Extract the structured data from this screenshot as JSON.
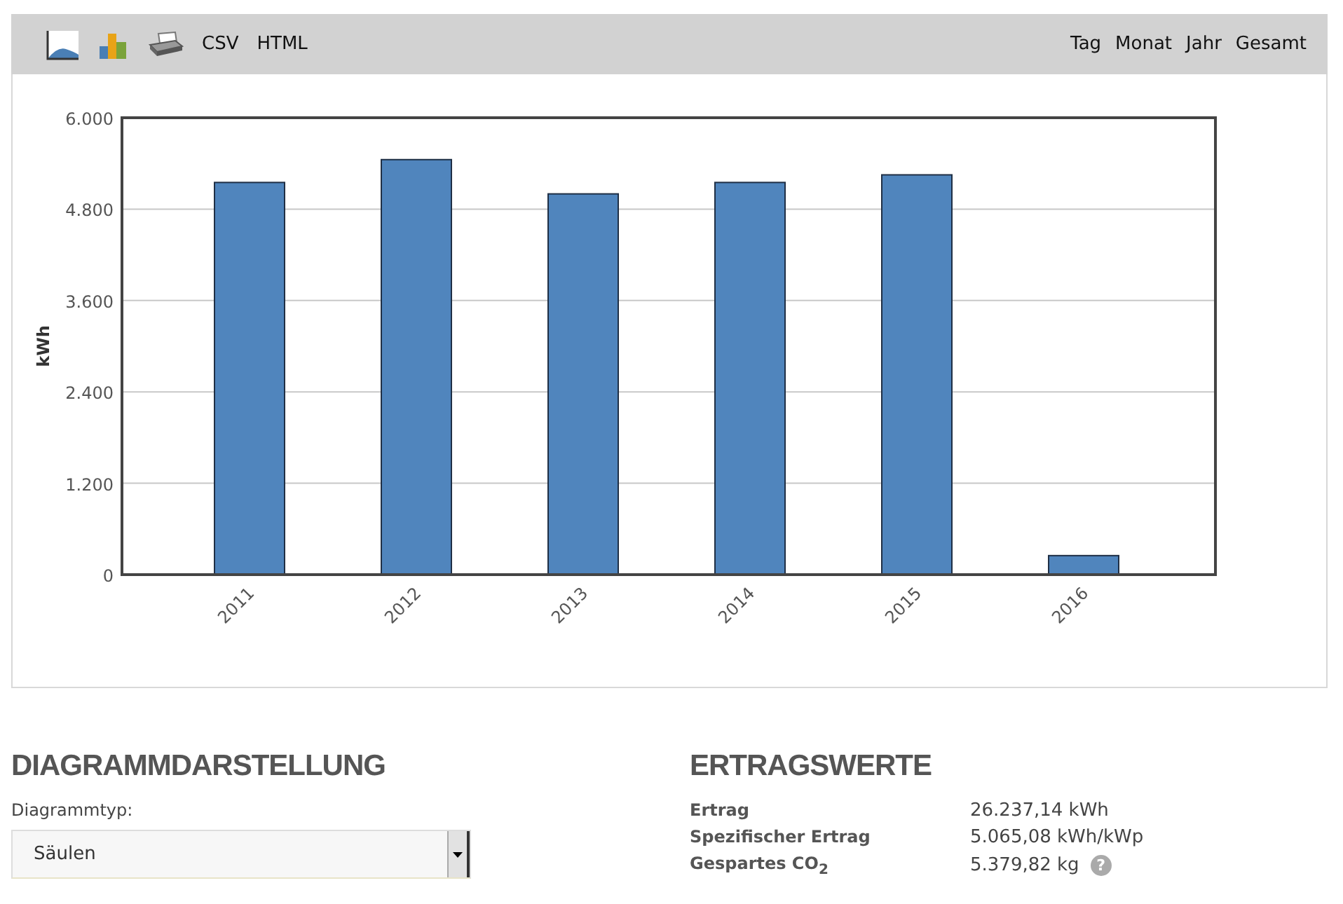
{
  "toolbar": {
    "exports": [
      "CSV",
      "HTML"
    ],
    "periods": [
      "Tag",
      "Monat",
      "Jahr",
      "Gesamt"
    ]
  },
  "chart": {
    "chart_data": {
      "type": "bar",
      "ylabel": "kWh",
      "categories": [
        "2011",
        "2012",
        "2013",
        "2014",
        "2015",
        "2016"
      ],
      "values": [
        5150,
        5450,
        5000,
        5150,
        5250,
        250
      ],
      "grid": true,
      "ylim": [
        0,
        6000
      ],
      "yticks": [
        {
          "value": 0,
          "label": "0"
        },
        {
          "value": 1200,
          "label": "1.200"
        },
        {
          "value": 2400,
          "label": "2.400"
        },
        {
          "value": 3600,
          "label": "3.600"
        },
        {
          "value": 4800,
          "label": "4.800"
        },
        {
          "value": 6000,
          "label": "6.000"
        }
      ]
    }
  },
  "diagram_settings": {
    "heading": "DIAGRAMMDARSTELLUNG",
    "label": "Diagrammtyp:",
    "value": "Säulen"
  },
  "yield_values": {
    "heading": "ERTRAGSWERTE",
    "rows": [
      {
        "label": "Ertrag",
        "value": "26.237,14 kWh"
      },
      {
        "label": "Spezifischer Ertrag",
        "value": "5.065,08 kWh/kWp"
      },
      {
        "label": "Gespartes CO$_{2}$",
        "value": "5.379,82 kg",
        "help": "?"
      }
    ]
  }
}
